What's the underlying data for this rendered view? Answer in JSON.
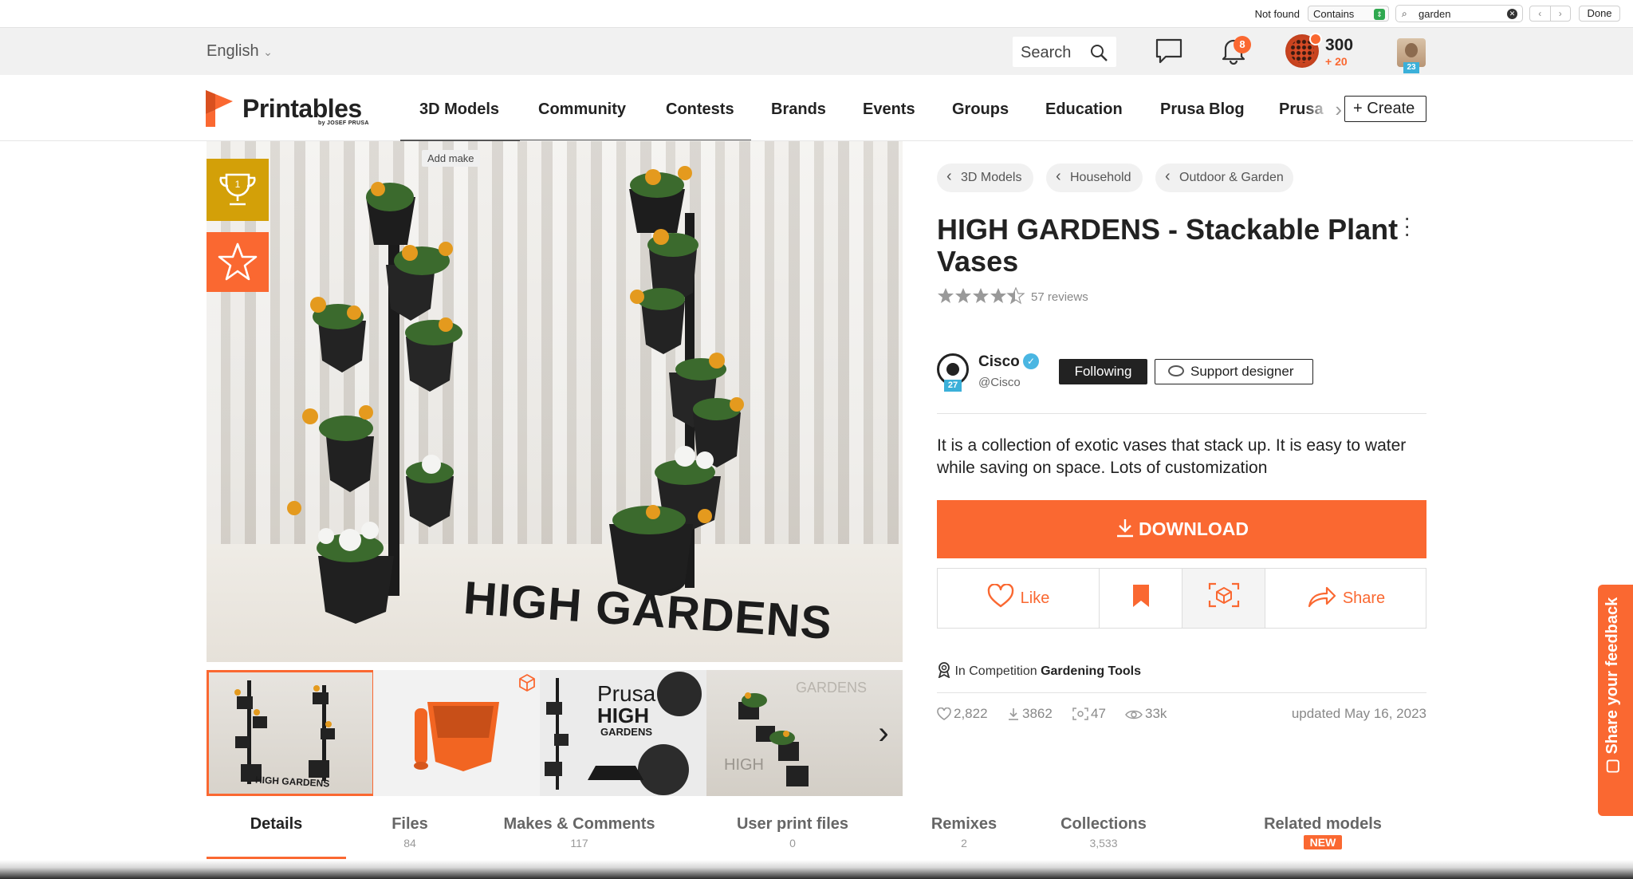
{
  "findbar": {
    "status": "Not found",
    "mode": "Contains",
    "query": "garden",
    "prev": "‹",
    "next": "›",
    "done": "Done"
  },
  "topbar": {
    "language": "English",
    "search_placeholder": "Search",
    "notifications_count": "8",
    "points": "300",
    "points_gain": "+ 20",
    "user_level": "23"
  },
  "nav": {
    "logo": "Printables",
    "logo_sub": "by JOSEF PRUSA",
    "items": [
      "3D Models",
      "Community",
      "Contests",
      "Brands",
      "Events",
      "Groups",
      "Education",
      "Prusa Blog",
      "Prusa"
    ],
    "create": "Create"
  },
  "gallery": {
    "add_make": "Add make",
    "hero_text": "HIGH GARDENS",
    "thumbs": [
      {
        "label": "HIGH GARDENS"
      },
      {
        "label": ""
      },
      {
        "label_top": "Prusa",
        "label_mid": "HIGH",
        "label_bottom": "GARDENS"
      },
      {
        "label_top": "GARDENS",
        "label_bottom": "HIGH"
      }
    ]
  },
  "breadcrumbs": [
    "3D Models",
    "Household",
    "Outdoor & Garden"
  ],
  "model": {
    "title": "HIGH GARDENS - Stackable Plant Vases",
    "rating": 4.5,
    "reviews": "57 reviews",
    "description": "It is a collection of exotic vases that stack up. It is easy to water while saving on space. Lots of customization",
    "download": "DOWNLOAD",
    "like": "Like",
    "share": "Share",
    "competition_prefix": "In Competition",
    "competition_name": "Gardening Tools",
    "updated": "updated May 16, 2023"
  },
  "designer": {
    "name": "Cisco",
    "handle": "@Cisco",
    "level": "27",
    "following": "Following",
    "support": "Support designer"
  },
  "stats": {
    "likes": "2,822",
    "downloads": "3862",
    "makes": "47",
    "views": "33k"
  },
  "tabs": [
    {
      "label": "Details",
      "count": ""
    },
    {
      "label": "Files",
      "count": "84"
    },
    {
      "label": "Makes & Comments",
      "count": "117"
    },
    {
      "label": "User print files",
      "count": "0"
    },
    {
      "label": "Remixes",
      "count": "2"
    },
    {
      "label": "Collections",
      "count": "3,533"
    },
    {
      "label": "Related models",
      "count": "",
      "badge": "NEW"
    }
  ],
  "feedback": "Share your feedback",
  "colors": {
    "accent": "#fa6831",
    "gold": "#d3a008",
    "text": "#222222",
    "verified": "#4ab6e2"
  }
}
